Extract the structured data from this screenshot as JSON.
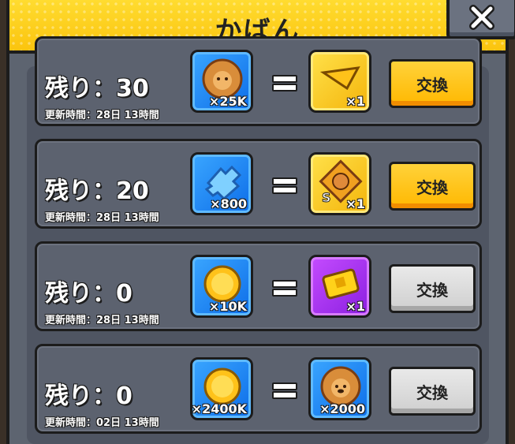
{
  "header": {
    "title": "かばん",
    "close_icon": "close-x-icon"
  },
  "rows": [
    {
      "remaining": "残り：30",
      "refresh": "更新時間：28日 13時間",
      "cost": {
        "icon": "lion-coin-icon",
        "qty": "×25K",
        "color": "blue"
      },
      "reward": {
        "icon": "golden-ticket-icon",
        "qty": "×1",
        "color": "gold"
      },
      "button": "交換",
      "button_state": "active"
    },
    {
      "remaining": "残り：20",
      "refresh": "更新時間：28日 13時間",
      "cost": {
        "icon": "blue-puzzle-icon",
        "qty": "×800",
        "color": "blue"
      },
      "reward": {
        "icon": "s-rank-puzzle-icon",
        "qty": "×1",
        "color": "gold"
      },
      "button": "交換",
      "button_state": "active"
    },
    {
      "remaining": "残り：0",
      "refresh": "更新時間：28日 13時間",
      "cost": {
        "icon": "gold-coin-icon",
        "qty": "×10K",
        "color": "blue"
      },
      "reward": {
        "icon": "gold-ticket-icon",
        "qty": "×1",
        "color": "purple"
      },
      "button": "交換",
      "button_state": "disabled"
    },
    {
      "remaining": "残り：0",
      "refresh": "更新時間：02日 13時間",
      "cost": {
        "icon": "gold-coin-icon",
        "qty": "×2400K",
        "color": "blue"
      },
      "reward": {
        "icon": "lion-coin-icon",
        "qty": "×2000",
        "color": "blue"
      },
      "button": "交換",
      "button_state": "disabled"
    }
  ]
}
